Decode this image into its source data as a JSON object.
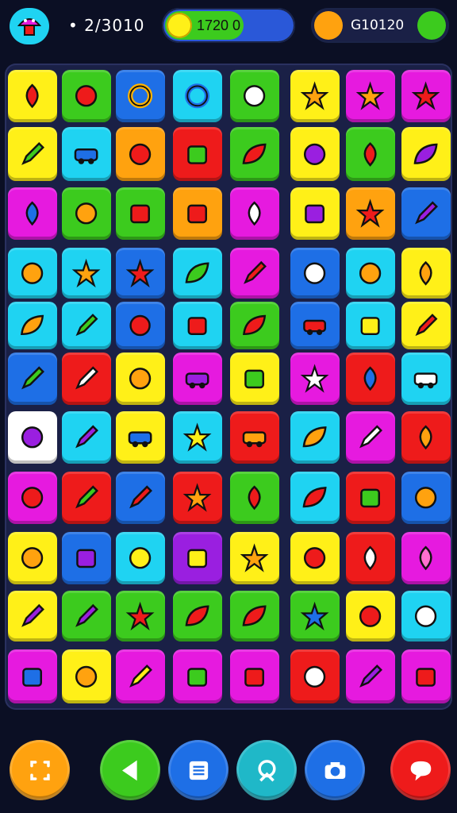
{
  "hud": {
    "move_counter": "• 2/3010",
    "coin_score": "1720 0",
    "gem_score": "G10120",
    "progress": 0.62
  },
  "colors": {
    "red": "#ee1b1b",
    "green": "#3ccb1e",
    "blue": "#1e6fe6",
    "cyan": "#1fd3f2",
    "yellow": "#fff018",
    "orange": "#ffa20f",
    "magenta": "#e61adf",
    "purple": "#9a1fe0",
    "white": "#ffffff"
  },
  "board": {
    "rows": [
      [
        "red-balloon-icon",
        "red-tomato-icon",
        "gold-ring-icon",
        "blue-ring-icon",
        "green-face-icon",
        "star-flower-icon",
        "sun-face-icon",
        "red-flower-icon"
      ],
      [
        "green-pencil-icon",
        "blue-bus-icon",
        "red-badge-icon",
        "green-jar-icon",
        "red-rocket-icon",
        "purple-banner-icon",
        "red-plant-icon",
        "purple-leaf-icon"
      ],
      [
        "blue-map-pin-icon",
        "orange-face-icon",
        "red-tv-icon",
        "red-crate-icon",
        "white-balloon-icon",
        "purple-box-icon",
        "red-sun-icon",
        "purple-pencil-icon"
      ],
      [
        "ghost-icon",
        "orange-sun-icon",
        "red-star-icon",
        "green-leaf-icon",
        "red-marker-icon",
        "white-flag-icon",
        "watermelon-icon",
        "orange-fire-icon"
      ],
      [
        "orange-fish-icon",
        "green-pencil-icon",
        "red-lantern-icon",
        "red-shop-icon",
        "red-rocket-icon",
        "red-car-icon",
        "yellow-jar-icon",
        "red-pen-icon"
      ],
      [
        "green-pencil-icon",
        "white-pencil-icon",
        "paperclip-icon",
        "purple-truck-icon",
        "green-bag-icon",
        "white-sun-face-icon",
        "blue-map-pin-icon",
        "white-car-icon"
      ],
      [
        "purple-filmstrip-icon",
        "purple-brush-icon",
        "blue-truck-icon",
        "yellow-sun-icon",
        "orange-truck-icon",
        "orange-fish-icon",
        "white-pencil-icon",
        "orange-fire-icon"
      ],
      [
        "red-heart-icon",
        "green-pencil-icon",
        "red-pencil-icon",
        "star-frame-icon",
        "red-balloon-icon",
        "red-fish-icon",
        "green-jar-icon",
        "orange-cross-icon"
      ],
      [
        "orange-fruit-icon",
        "purple-jar-icon",
        "yellow-lemon-icon",
        "yellow-screen-icon",
        "orange-star-icon",
        "red-face-icon",
        "red-plant-icon",
        "pink-balloon-icon"
      ],
      [
        "purple-pencil-icon",
        "purple-pencil-icon",
        "red-starfish-icon",
        "red-leaf-icon",
        "red-leaf-icon",
        "blue-sun-icon",
        "red-vase-icon",
        "cyan-face-icon"
      ],
      [
        "blue-book-icon",
        "cat-face-icon",
        "yellow-pencil-icon",
        "green-frame-icon",
        "red-frame-icon",
        "red-bear-icon",
        "purple-spoon-icon",
        "red-jar-icon"
      ]
    ]
  },
  "controls": [
    "shuffle-button",
    "back-button",
    "menu-button",
    "settings-button",
    "camera-button",
    "hint-button"
  ]
}
